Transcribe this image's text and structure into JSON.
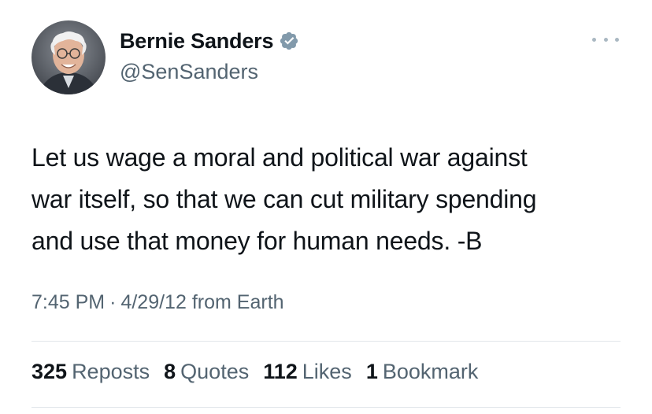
{
  "author": {
    "display_name": "Bernie Sanders",
    "handle": "@SenSanders",
    "verified_color": "#829aab",
    "avatar_icon": "profile-photo"
  },
  "tweet": {
    "text_lines": [
      "Let us wage a moral and political war against",
      "war itself, so that we can cut military spending",
      "and use that money for human needs. -B"
    ]
  },
  "meta": {
    "time": "7:45 PM",
    "separator": "·",
    "date": "4/29/12",
    "source": "from Earth"
  },
  "stats": [
    {
      "count": "325",
      "label": "Reposts"
    },
    {
      "count": "8",
      "label": "Quotes"
    },
    {
      "count": "112",
      "label": "Likes"
    },
    {
      "count": "1",
      "label": "Bookmark"
    }
  ],
  "colors": {
    "text_primary": "#0f1419",
    "text_secondary": "#536471",
    "divider": "#e1e6ea"
  }
}
